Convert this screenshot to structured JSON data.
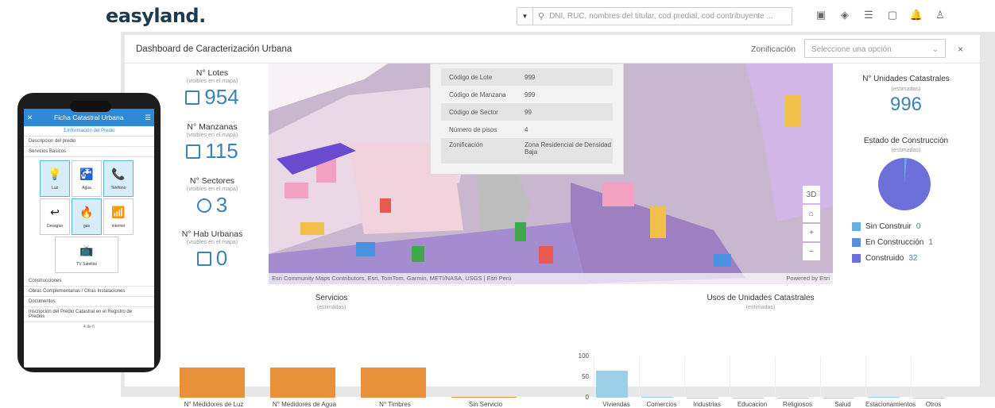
{
  "header": {
    "logo": "easyland.",
    "search_placeholder": "DNI, RUC, nombres del titular, cod predial, cod contribuyente ...",
    "icons": [
      "save-icon",
      "layers-icon",
      "list-icon",
      "chat-icon",
      "bell-icon",
      "user-icon"
    ]
  },
  "dashboard": {
    "title": "Dashboard de Caracterización Urbana",
    "zonificacion_label": "Zonificación",
    "zonificacion_placeholder": "Seleccione una opción"
  },
  "stats": [
    {
      "title": "N° Lotes",
      "sub": "(visibles en el mapa)",
      "value": "954"
    },
    {
      "title": "N° Manzanas",
      "sub": "(visibles en el mapa)",
      "value": "115"
    },
    {
      "title": "N° Sectores",
      "sub": "(visibles en el mapa)",
      "value": "3"
    },
    {
      "title": "N° Hab Urbanas",
      "sub": "(visibles en el mapa)",
      "value": "0"
    }
  ],
  "popup": [
    {
      "k": "Código de Lote",
      "v": "999"
    },
    {
      "k": "Código de Manzana",
      "v": "999"
    },
    {
      "k": "Código de Sector",
      "v": "99"
    },
    {
      "k": "Número de pisos",
      "v": "4"
    },
    {
      "k": "Zonificación",
      "v": "Zona Residencial de Densidad Baja"
    }
  ],
  "map": {
    "controls": [
      "3D",
      "⌂",
      "+",
      "−"
    ],
    "attribution": "Esri Community Maps Contributors, Esri, TomTom, Garmin, METI/NASA, USGS | Esri Perú",
    "powered": "Powered by Esri"
  },
  "right": {
    "units_title": "N° Unidades Catastrales",
    "units_sub": "(estimadas)",
    "units_value": "996",
    "estado_title": "Estado de Construcción",
    "estado_sub": "(estimadas)",
    "legend": [
      {
        "label": "Sin Construir",
        "value": "0",
        "color": "#6aaedf"
      },
      {
        "label": "En Construcción",
        "value": "1",
        "color": "#5b8fd6"
      },
      {
        "label": "Construido",
        "value": "32",
        "color": "#6d70d8"
      }
    ]
  },
  "servicios": {
    "title": "Servicios",
    "sub": "(estimadas)"
  },
  "usos": {
    "title": "Usos de Unidades Catastrales",
    "sub": "(estimadas)"
  },
  "chart_data": [
    {
      "type": "bar",
      "title": "Servicios",
      "categories": [
        "N° Medidores de Luz",
        "N° Medidores de Agua",
        "N° Timbres",
        "Sin Servicio"
      ],
      "values": [
        30,
        30,
        30,
        0.5
      ]
    },
    {
      "type": "bar",
      "title": "Usos de Unidades Catastrales",
      "categories": [
        "Viviendas",
        "Comercios",
        "Industrias",
        "Educacion",
        "Religiosos",
        "Salud",
        "Estacionamientos",
        "Otros"
      ],
      "values": [
        66,
        2,
        0,
        0,
        0,
        0,
        1,
        0
      ],
      "yticks": [
        0,
        50,
        100
      ],
      "ylim": [
        0,
        100
      ]
    }
  ],
  "phone": {
    "header": "Ficha Catastral Urbana",
    "section": "3.Información del Predio",
    "rows_top": [
      "Descripcion del predio",
      "Servicios Básicos"
    ],
    "cells": [
      {
        "label": "Luz",
        "glyph": "💡",
        "on": true
      },
      {
        "label": "Agua",
        "glyph": "🚰",
        "on": false
      },
      {
        "label": "Teléfono",
        "glyph": "📞",
        "on": true
      },
      {
        "label": "Desagüe",
        "glyph": "↩",
        "on": false
      },
      {
        "label": "gas",
        "glyph": "🔥",
        "on": true
      },
      {
        "label": "Internet",
        "glyph": "📶",
        "on": false
      },
      {
        "label": "TV Satelital",
        "glyph": "📺",
        "on": false
      }
    ],
    "rows_bottom": [
      "Construcciones",
      "Obras Complementarias / Otras Instalaciones",
      "Documentos",
      "Inscripción del Predio Catastral en el Registro de Predios"
    ],
    "footer": "4 de 6"
  }
}
